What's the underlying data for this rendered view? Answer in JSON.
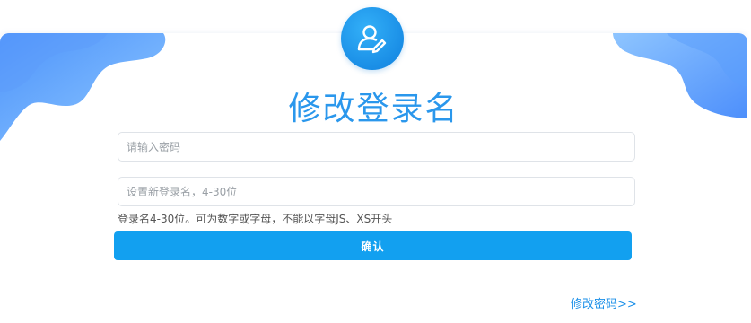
{
  "page": {
    "title": "修改登录名"
  },
  "form": {
    "password_placeholder": "请输入密码",
    "login_name_placeholder": "设置新登录名，4-30位",
    "hint": "登录名4-30位。可为数字或字母，不能以字母JS、XS开头",
    "confirm_label": "确认"
  },
  "links": {
    "change_password": "修改密码>>"
  },
  "icons": {
    "avatar": "user-edit-icon"
  },
  "colors": {
    "accent": "#12a0f0",
    "title": "#2a97ec",
    "wave_light": "#8ec5ff",
    "wave_dark": "#5a9dfc"
  }
}
